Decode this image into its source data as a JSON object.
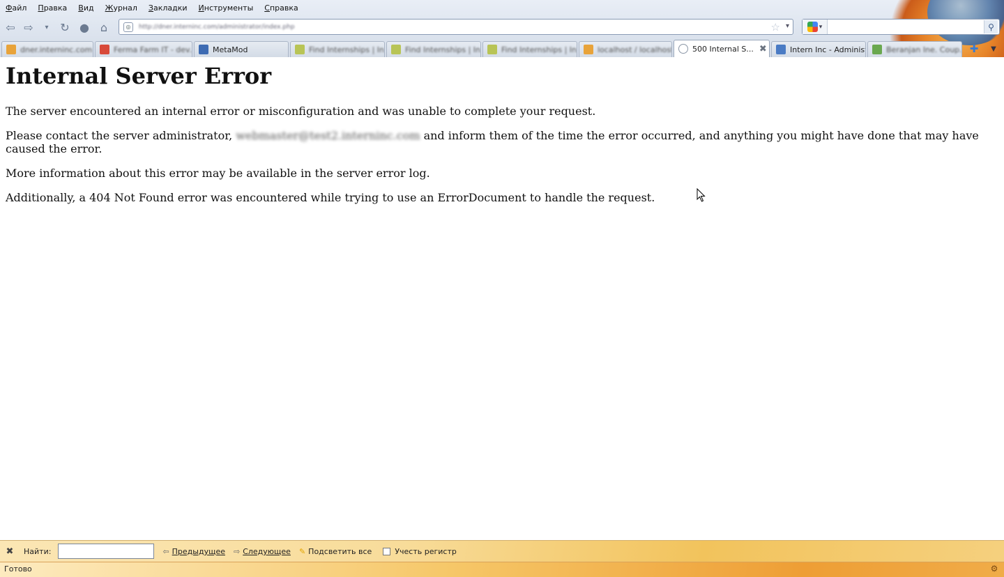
{
  "menubar": {
    "items": [
      "Файл",
      "Правка",
      "Вид",
      "Журнал",
      "Закладки",
      "Инструменты",
      "Справка"
    ]
  },
  "navbar": {
    "url": "http://dner.interninc.com/administrator/index.php",
    "search_value": ""
  },
  "tabs": [
    {
      "label": "dner.interninc.com /",
      "blurred": true,
      "icon_color": "#e8a33a"
    },
    {
      "label": "Ferma Farm IT - dev...",
      "blurred": true,
      "icon_color": "#d84a3a"
    },
    {
      "label": "MetaMod",
      "blurred": false,
      "icon_color": "#3d6bb3"
    },
    {
      "label": "Find Internships | In...",
      "blurred": true,
      "icon_color": "#b8c456"
    },
    {
      "label": "Find Internships | In...",
      "blurred": true,
      "icon_color": "#b8c456"
    },
    {
      "label": "Find Internships | In...",
      "blurred": true,
      "icon_color": "#b8c456"
    },
    {
      "label": "localhost / localhost /...",
      "blurred": true,
      "icon_color": "#e8a33a"
    },
    {
      "label": "500 Internal S...",
      "blurred": false,
      "active": true,
      "icon_color": "#8a96a6"
    },
    {
      "label": "Intern Inc - Administr...",
      "blurred": false,
      "icon_color": "#4a7bc4"
    },
    {
      "label": "Beranjan Ine. Coup...",
      "blurred": true,
      "icon_color": "#6aa84f"
    }
  ],
  "page": {
    "title": "Internal Server Error",
    "p1": "The server encountered an internal error or misconfiguration and was unable to complete your request.",
    "p2_before": "Please contact the server administrator, ",
    "p2_email": "webmaster@test2.interninc.com",
    "p2_after": " and inform them of the time the error occurred, and anything you might have done that may have caused the error.",
    "p3": "More information about this error may be available in the server error log.",
    "p4": "Additionally, a 404 Not Found error was encountered while trying to use an ErrorDocument to handle the request."
  },
  "findbar": {
    "label": "Найти:",
    "value": "",
    "prev": "Предыдущее",
    "next": "Следующее",
    "highlight": "Подсветить все",
    "match_case": "Учесть регистр"
  },
  "statusbar": {
    "text": "Готово"
  }
}
